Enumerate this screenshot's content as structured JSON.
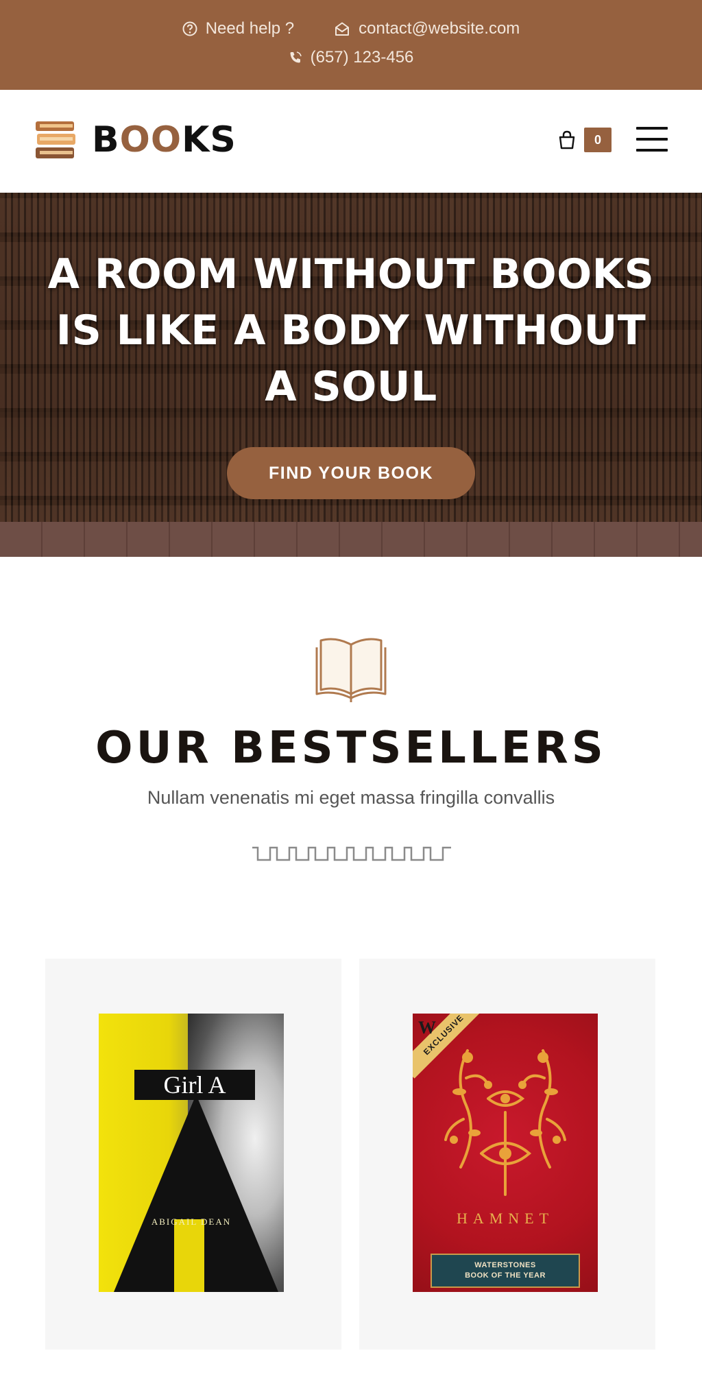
{
  "topbar": {
    "help_label": "Need help ?",
    "email": "contact@website.com",
    "phone": "(657) 123-456",
    "icons": [
      "help-circle-icon",
      "mail-icon",
      "phone-icon"
    ]
  },
  "header": {
    "logo_text_b": "B",
    "logo_text_oo": "OO",
    "logo_text_ks": "KS",
    "cart_count": "0",
    "icons": [
      "books-logo-icon",
      "shopping-bag-icon",
      "hamburger-menu-icon"
    ]
  },
  "hero": {
    "title": "A ROOM WITHOUT BOOKS IS LIKE A BODY WITHOUT A SOUL",
    "cta_label": "FIND YOUR BOOK"
  },
  "bestsellers": {
    "icon": "open-book-icon",
    "title": "OUR BESTSELLERS",
    "subtitle": "Nullam venenatis mi eget massa fringilla convallis",
    "books": [
      {
        "cover_title": "Girl A",
        "cover_author": "ABIGAIL DEAN"
      },
      {
        "cover_title": "HAMNET",
        "sash": "EXCLUSIVE",
        "w_mark": "W",
        "label_line1": "WATERSTONES",
        "label_line2": "BOOK OF THE YEAR"
      }
    ]
  },
  "colors": {
    "brand": "#96613f",
    "text_dark": "#1a1410",
    "card_bg": "#f6f6f6"
  }
}
